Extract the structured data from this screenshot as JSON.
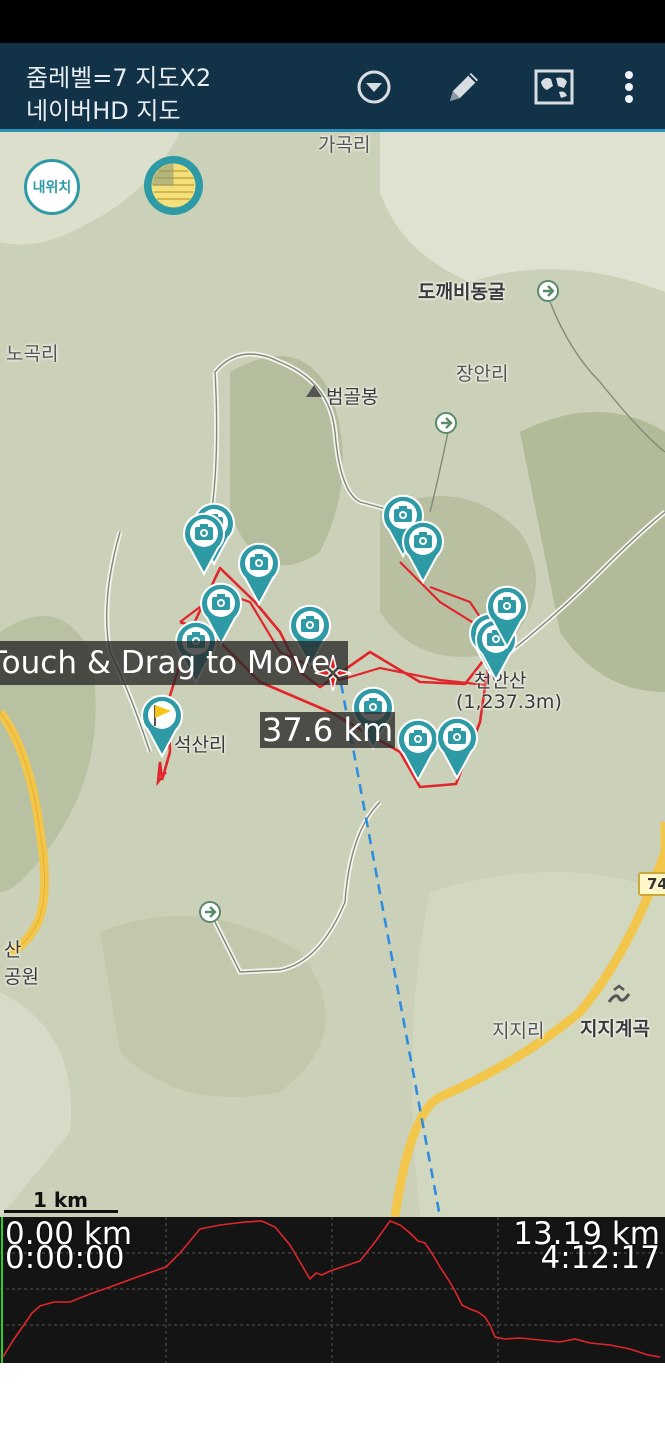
{
  "app_bar": {
    "title_line1": "줌레벨=7 지도X2",
    "title_line2": "네이버HD 지도",
    "icons": [
      "dropdown-circle-icon",
      "pencil-icon",
      "map-icon",
      "more-vert-icon"
    ],
    "color": "#123248"
  },
  "map": {
    "my_location_label": "내위치",
    "labels": {
      "gagokri": "가곡리",
      "dokkaebi_cave": "도깨비동굴",
      "nogokri": "노곡리",
      "jangan_ri": "장안리",
      "beomgolbong": "범골봉",
      "cheonansan": "천안산",
      "cheonansan_height": "(1,237.3m)",
      "seoksanri": "석산리",
      "park_1": "산",
      "park_2": "공원",
      "jijiri": "지지리",
      "jiji_valley": "지지계곡",
      "route_74": "74"
    },
    "overlay_hint": "Touch & Drag to Move",
    "distance": "37.6 km",
    "scale_label": "1 km",
    "track_color": "#e0262b",
    "pin_color": "#2e9aa6"
  },
  "elevation": {
    "start_distance": "0.00 km",
    "start_time": "0:00:00",
    "end_distance": "13.19 km",
    "end_time": "4:12:17"
  }
}
